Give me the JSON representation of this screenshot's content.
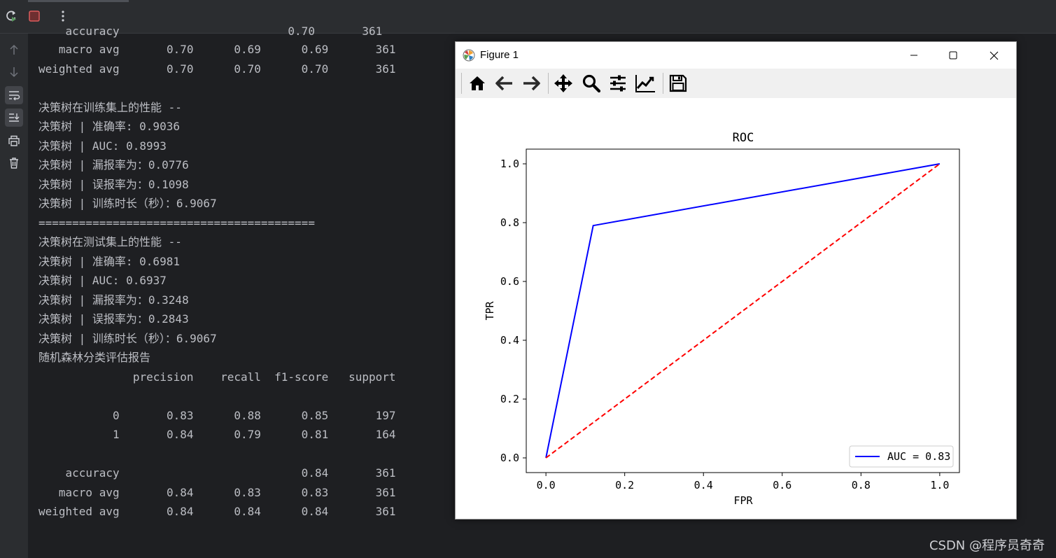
{
  "toolbar": {
    "icons": [
      "rerun-icon",
      "stop-icon",
      "more-icon"
    ]
  },
  "sidebar": {
    "icons": [
      "arrow-up-icon",
      "arrow-down-icon",
      "soft-wrap-icon",
      "scroll-to-end-icon",
      "print-icon",
      "trash-icon"
    ]
  },
  "console": {
    "lines": [
      "    accuracy                         0.70       361",
      "   macro avg       0.70      0.69      0.69       361",
      "weighted avg       0.70      0.70      0.70       361",
      "",
      "决策树在训练集上的性能 --",
      "决策树 | 准确率: 0.9036",
      "决策树 | AUC: 0.8993",
      "决策树 | 漏报率为：0.0776",
      "决策树 | 误报率为：0.1098",
      "决策树 | 训练时长（秒）：6.9067",
      "=========================================",
      "决策树在测试集上的性能 --",
      "决策树 | 准确率: 0.6981",
      "决策树 | AUC: 0.6937",
      "决策树 | 漏报率为：0.3248",
      "决策树 | 误报率为：0.2843",
      "决策树 | 训练时长（秒）：6.9067",
      "随机森林分类评估报告",
      "              precision    recall  f1-score   support",
      "",
      "           0       0.83      0.88      0.85       197",
      "           1       0.84      0.79      0.81       164",
      "",
      "    accuracy                           0.84       361",
      "   macro avg       0.84      0.83      0.83       361",
      "weighted avg       0.84      0.84      0.84       361"
    ]
  },
  "figure": {
    "title": "Figure 1",
    "window_icons": [
      "matplotlib-logo-icon",
      "minimize-icon",
      "maximize-icon",
      "close-icon"
    ],
    "tools": [
      "home-icon",
      "back-icon",
      "forward-icon",
      "pan-icon",
      "zoom-icon",
      "configure-subplots-icon",
      "edit-axis-icon",
      "save-icon"
    ]
  },
  "chart_data": {
    "type": "line",
    "title": "ROC",
    "xlabel": "FPR",
    "ylabel": "TPR",
    "xlim": [
      -0.05,
      1.05
    ],
    "ylim": [
      -0.05,
      1.05
    ],
    "xticks": [
      "0.0",
      "0.2",
      "0.4",
      "0.6",
      "0.8",
      "1.0"
    ],
    "yticks": [
      "0.0",
      "0.2",
      "0.4",
      "0.6",
      "0.8",
      "1.0"
    ],
    "grid": false,
    "legend": "lower right",
    "series": [
      {
        "name": "AUC = 0.83",
        "color": "#0000ff",
        "style": "solid",
        "x": [
          0.0,
          0.12,
          1.0
        ],
        "y": [
          0.0,
          0.79,
          1.0
        ]
      },
      {
        "color": "#ff0000",
        "style": "dashed",
        "x": [
          0.0,
          1.0
        ],
        "y": [
          0.0,
          1.0
        ]
      }
    ]
  },
  "watermark": "CSDN @程序员奇奇"
}
